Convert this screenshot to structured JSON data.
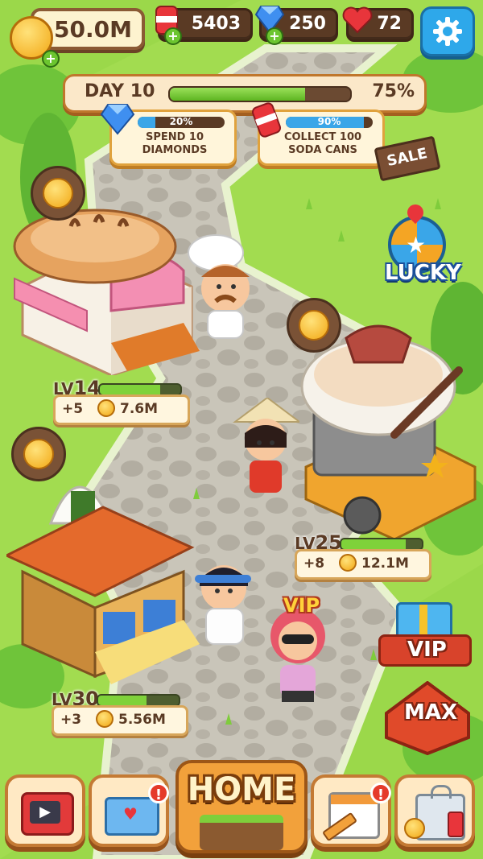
{
  "resources": {
    "coins": "50.0M",
    "soda_cans": "5403",
    "diamonds": "250",
    "hearts": "72"
  },
  "day": {
    "label": "DAY 10",
    "progress_label": "75%",
    "progress": 0.75
  },
  "tasks": [
    {
      "progress_label": "20%",
      "progress": 0.2,
      "title_line1": "SPEND 10",
      "title_line2": "DIAMONDS",
      "icon": "diamond-icon"
    },
    {
      "progress_label": "90%",
      "progress": 0.9,
      "title_line1": "COLLECT 100",
      "title_line2": "SODA CANS",
      "icon": "soda-can-icon"
    }
  ],
  "sale_sign": "SALE",
  "lucky_label": "LUCKY",
  "vip_label": "VIP",
  "vip_tag": "VIP",
  "max_label": "MAX",
  "shops": {
    "bakery": {
      "level_prefix": "LV",
      "level": "14",
      "bonus": "+5",
      "income": "7.6M",
      "progress": 0.75
    },
    "noodle": {
      "level_prefix": "LV",
      "level": "25",
      "bonus": "+8",
      "income": "12.1M",
      "progress": 0.8
    },
    "onigiri": {
      "level_prefix": "LV",
      "level": "30",
      "bonus": "+3",
      "income": "5.56M",
      "progress": 0.6
    }
  },
  "nav": {
    "home_label": "HOME",
    "mail_alert": "!",
    "calendar_alert": "!"
  },
  "colors": {
    "grass": "#9bd84a",
    "road": "#bdb9ad",
    "panel": "#fbe8c9",
    "accent_red": "#d8432b"
  }
}
